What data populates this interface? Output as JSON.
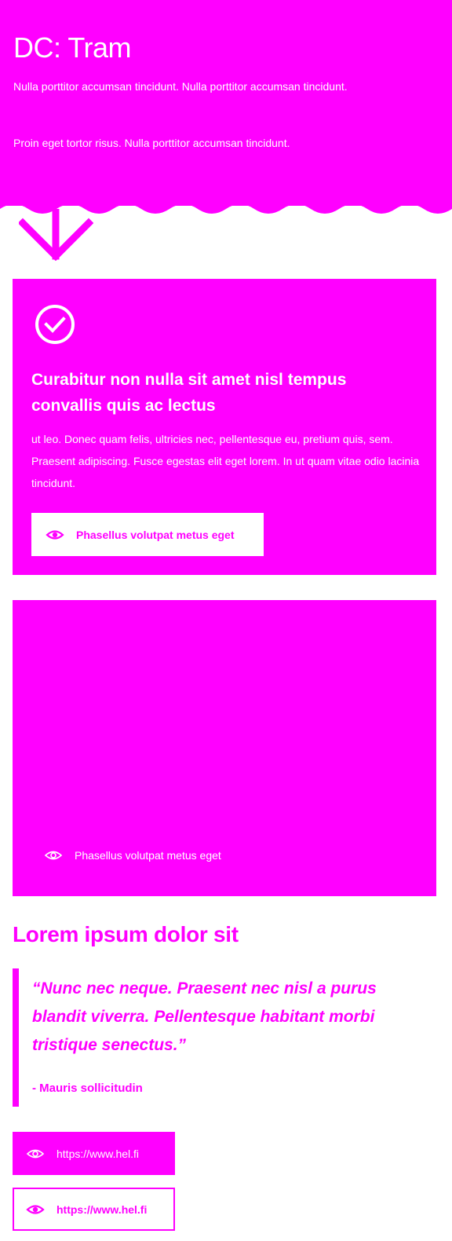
{
  "hero": {
    "title": "DC: Tram",
    "paragraph1": "Nulla porttitor accumsan tincidunt. Nulla porttitor accumsan tincidunt.",
    "paragraph2": "Proin eget tortor risus. Nulla porttitor accumsan tincidunt."
  },
  "card1": {
    "icon": "check-circle-icon",
    "title": "Curabitur non nulla sit amet nisl tempus convallis quis ac lectus",
    "text": "ut leo. Donec quam felis, ultricies nec, pellentesque eu, pretium quis, sem. Praesent adipiscing. Fusce egestas elit eget lorem. In ut quam vitae odio lacinia tincidunt.",
    "button_label": "Phasellus volutpat metus eget"
  },
  "card2": {
    "link_label": "Phasellus volutpat metus eget"
  },
  "section": {
    "title": "Lorem ipsum dolor sit",
    "quote": "“Nunc nec neque. Praesent nec nisl a purus blandit viverra. Pellentesque habitant morbi tristique senectus.”",
    "cite": "- Mauris sollicitudin"
  },
  "links": {
    "filled_label": "https://www.hel.fi",
    "outline_label": "https://www.hel.fi"
  },
  "colors": {
    "accent": "#ff00ff",
    "text_on_accent": "#ffffff",
    "background": "#ffffff"
  }
}
